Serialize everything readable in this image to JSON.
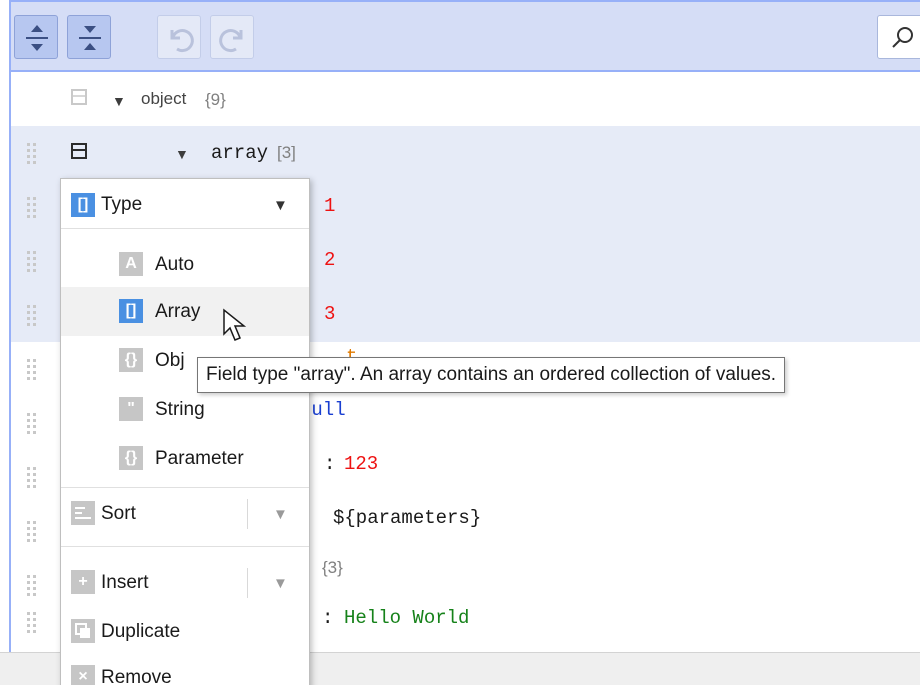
{
  "toolbar": {
    "buttons": [
      {
        "name": "expand-all",
        "icon": "expand-all-icon",
        "state": "enabled"
      },
      {
        "name": "collapse-all",
        "icon": "collapse-all-icon",
        "state": "enabled"
      },
      {
        "name": "undo",
        "icon": "undo-icon",
        "state": "disabled"
      },
      {
        "name": "redo",
        "icon": "redo-icon",
        "state": "disabled"
      }
    ],
    "search_icon": "search-icon"
  },
  "tree": {
    "root": {
      "field": "object",
      "count": "{9}"
    },
    "array_node": {
      "field": "array",
      "count": "[3]"
    },
    "array_items": [
      {
        "value": "1"
      },
      {
        "value": "2"
      },
      {
        "value": "3"
      }
    ],
    "rows_partial": {
      "row_bool_value": "t",
      "row_null_value": "null",
      "row_number_sep": ":",
      "row_number_value": "123",
      "row_param_value": "${parameters}",
      "row_obj_count": "{3}",
      "row_string_sep": ":",
      "row_string_value": "Hello World"
    }
  },
  "context_menu": {
    "type_label": "Type",
    "type_options": [
      {
        "label": "Auto",
        "icon_glyph": "A",
        "icon": "auto-type-icon"
      },
      {
        "label": "Array",
        "icon_glyph": "[]",
        "icon": "array-type-icon"
      },
      {
        "label": "Obj",
        "icon_glyph": "{}",
        "icon": "object-type-icon"
      },
      {
        "label": "String",
        "icon_glyph": "\"",
        "icon": "string-type-icon"
      },
      {
        "label": "Parameter",
        "icon_glyph": "{}",
        "icon": "parameter-type-icon"
      }
    ],
    "sort_label": "Sort",
    "insert_label": "Insert",
    "duplicate_label": "Duplicate",
    "remove_label": "Remove",
    "type_head_glyph": "[]",
    "dropdown_arrow": "▼"
  },
  "tooltip": {
    "text": "Field type \"array\". An array contains an ordered collection of values."
  },
  "colors": {
    "toolbar_bg": "#d5ddf6",
    "border": "#97b0f8",
    "number": "#ee1212",
    "string": "#16821a",
    "null": "#1a3fd1",
    "selected_row": "#e6ebf7",
    "type_icon_active": "#4a90e2"
  }
}
